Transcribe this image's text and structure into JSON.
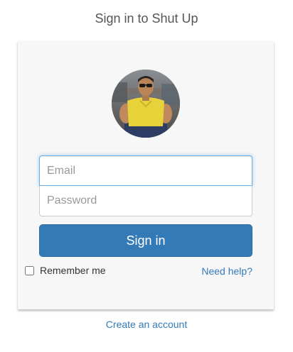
{
  "header": {
    "title": "Sign in to Shut Up"
  },
  "form": {
    "email_placeholder": "Email",
    "email_value": "",
    "password_placeholder": "Password",
    "password_value": "",
    "submit_label": "Sign in",
    "remember_label": "Remember me",
    "remember_checked": false,
    "help_label": "Need help?"
  },
  "footer": {
    "create_account_label": "Create an account"
  },
  "colors": {
    "accent": "#337ab7",
    "card_background": "#f7f7f7",
    "focus_border": "#66afe9"
  },
  "icons": {
    "avatar": "profile-photo"
  }
}
